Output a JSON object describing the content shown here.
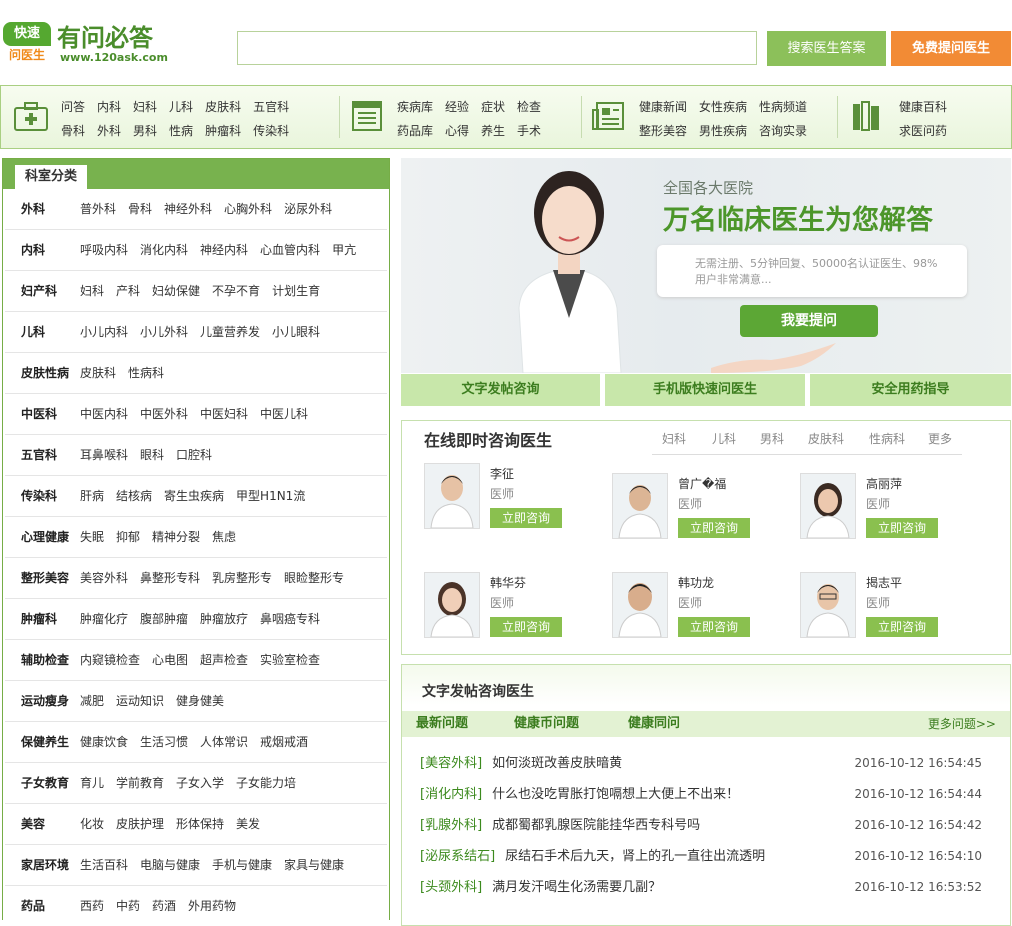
{
  "header": {
    "logo_top": "快速",
    "logo_bottom": "问医生",
    "title": "有问必答",
    "url": "www.120ask.com",
    "search_value": "",
    "search_button": "搜索医生答案",
    "ask_button": "免费提问医生"
  },
  "nav": {
    "group1": [
      [
        "问答",
        "内科",
        "妇科",
        "儿科",
        "皮肤科",
        "五官科"
      ],
      [
        "骨科",
        "外科",
        "男科",
        "性病",
        "肿瘤科",
        "传染科"
      ]
    ],
    "group2": [
      [
        "疾病库",
        "经验",
        "症状",
        "检查"
      ],
      [
        "药品库",
        "心得",
        "养生",
        "手术"
      ]
    ],
    "group3": [
      [
        "健康新闻",
        "女性疾病",
        "性病频道"
      ],
      [
        "整形美容",
        "男性疾病",
        "咨询实录"
      ]
    ],
    "group4": [
      [
        "健康百科"
      ],
      [
        "求医问药"
      ]
    ]
  },
  "departments": {
    "tab": "科室分类",
    "rows": [
      {
        "cat": "外科",
        "subs": [
          "普外科",
          "骨科",
          "神经外科",
          "心胸外科",
          "泌尿外科"
        ]
      },
      {
        "cat": "内科",
        "subs": [
          "呼吸内科",
          "消化内科",
          "神经内科",
          "心血管内科",
          "甲亢"
        ]
      },
      {
        "cat": "妇产科",
        "subs": [
          "妇科",
          "产科",
          "妇幼保健",
          "不孕不育",
          "计划生育"
        ]
      },
      {
        "cat": "儿科",
        "subs": [
          "小儿内科",
          "小儿外科",
          "儿童营养发",
          "小儿眼科"
        ]
      },
      {
        "cat": "皮肤性病",
        "subs": [
          "皮肤科",
          "性病科"
        ]
      },
      {
        "cat": "中医科",
        "subs": [
          "中医内科",
          "中医外科",
          "中医妇科",
          "中医儿科"
        ]
      },
      {
        "cat": "五官科",
        "subs": [
          "耳鼻喉科",
          "眼科",
          "口腔科"
        ]
      },
      {
        "cat": "传染科",
        "subs": [
          "肝病",
          "结核病",
          "寄生虫疾病",
          "甲型H1N1流"
        ]
      },
      {
        "cat": "心理健康",
        "subs": [
          "失眠",
          "抑郁",
          "精神分裂",
          "焦虑"
        ]
      },
      {
        "cat": "整形美容",
        "subs": [
          "美容外科",
          "鼻整形专科",
          "乳房整形专",
          "眼睑整形专"
        ]
      },
      {
        "cat": "肿瘤科",
        "subs": [
          "肿瘤化疗",
          "腹部肿瘤",
          "肿瘤放疗",
          "鼻咽癌专科"
        ]
      },
      {
        "cat": "辅助检查",
        "subs": [
          "内窥镜检查",
          "心电图",
          "超声检查",
          "实验室检查"
        ]
      },
      {
        "cat": "运动瘦身",
        "subs": [
          "减肥",
          "运动知识",
          "健身健美"
        ]
      },
      {
        "cat": "保健养生",
        "subs": [
          "健康饮食",
          "生活习惯",
          "人体常识",
          "戒烟戒酒"
        ]
      },
      {
        "cat": "子女教育",
        "subs": [
          "育儿",
          "学前教育",
          "子女入学",
          "子女能力培"
        ]
      },
      {
        "cat": "美容",
        "subs": [
          "化妆",
          "皮肤护理",
          "形体保持",
          "美发"
        ]
      },
      {
        "cat": "家居环境",
        "subs": [
          "生活百科",
          "电脑与健康",
          "手机与健康",
          "家具与健康"
        ]
      },
      {
        "cat": "药品",
        "subs": [
          "西药",
          "中药",
          "药酒",
          "外用药物"
        ]
      }
    ]
  },
  "banner": {
    "subtitle": "全国各大医院",
    "title": "万名临床医生为您解答",
    "text": "无需注册、5分钟回复、50000名认证医生、98%用户非常满意...",
    "button": "我要提问"
  },
  "strip_tabs": [
    "文字发帖咨询",
    "手机版快速问医生",
    "安全用药指导"
  ],
  "online": {
    "title": "在线即时咨询医生",
    "tabs": [
      "妇科",
      "儿科",
      "男科",
      "皮肤科",
      "性病科",
      "更多"
    ],
    "button": "立即咨询",
    "doctors": [
      {
        "name": "李征",
        "title": "医师"
      },
      {
        "name": "曾广�福",
        "title": "医师"
      },
      {
        "name": "高丽萍",
        "title": "医师"
      },
      {
        "name": "韩华芬",
        "title": "医师"
      },
      {
        "name": "韩功龙",
        "title": "医师"
      },
      {
        "name": "揭志平",
        "title": "医师"
      }
    ]
  },
  "consult": {
    "title": "文字发帖咨询医生",
    "tabs": [
      "最新问题",
      "健康币问题",
      "健康同问"
    ],
    "more": "更多问题>>",
    "questions": [
      {
        "cat": "[美容外科]",
        "text": "如何淡斑改善皮肤暗黄",
        "time": "2016-10-12 16:54:45"
      },
      {
        "cat": "[消化内科]",
        "text": "什么也没吃胃胀打饱嗝想上大便上不出来！",
        "time": "2016-10-12 16:54:44"
      },
      {
        "cat": "[乳腺外科]",
        "text": "成都蜀都乳腺医院能挂华西专科号吗",
        "time": "2016-10-12 16:54:42"
      },
      {
        "cat": "[泌尿系结石]",
        "text": "尿结石手术后九天，肾上的孔一直往出流透明",
        "time": "2016-10-12 16:54:10"
      },
      {
        "cat": "[头颈外科]",
        "text": "满月发汗喝生化汤需要几副？",
        "time": "2016-10-12 16:53:52"
      }
    ]
  }
}
